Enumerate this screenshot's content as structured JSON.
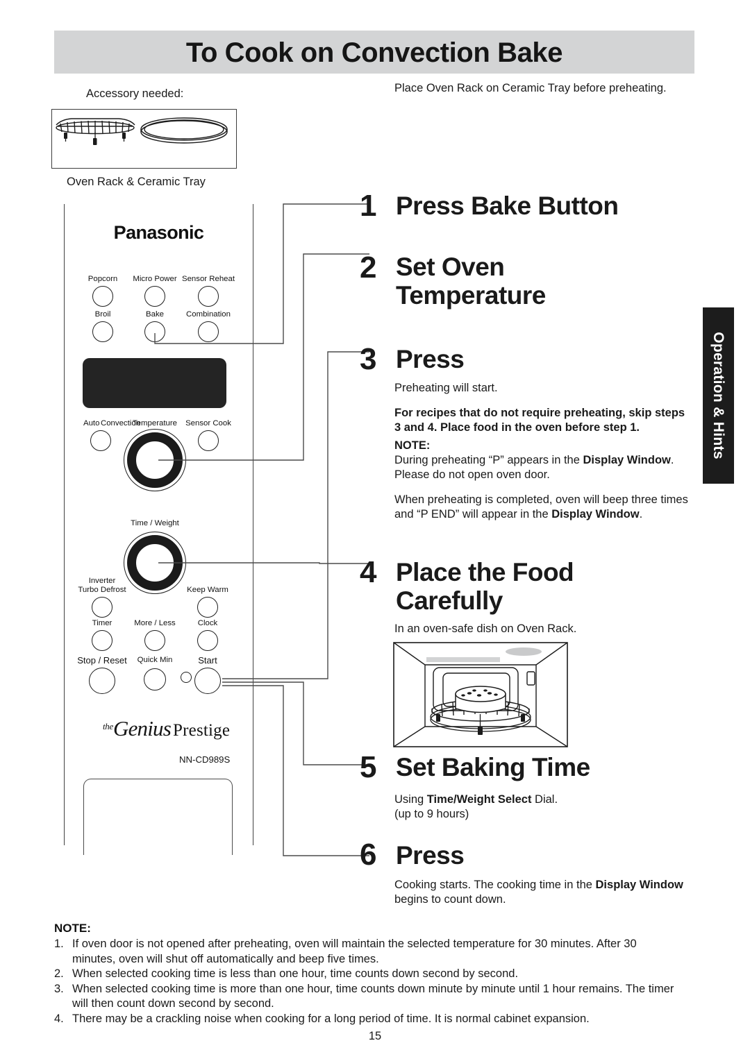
{
  "header": {
    "title": "To Cook on Convection Bake"
  },
  "side_tab": {
    "label": "Operation & Hints"
  },
  "accessory": {
    "label": "Accessory needed:",
    "caption": "Oven Rack & Ceramic Tray"
  },
  "intro": {
    "text": "Place Oven Rack on Ceramic Tray before preheating."
  },
  "panel": {
    "brand": "Panasonic",
    "model": "NN-CD989S",
    "logo_the": "the",
    "logo_script": "Genius",
    "logo_prestige": "Prestige",
    "buttons": [
      {
        "label": "Popcorn"
      },
      {
        "label": "Micro Power"
      },
      {
        "label": "Sensor Reheat"
      },
      {
        "label": "Broil"
      },
      {
        "label": "Bake"
      },
      {
        "label": "Combination"
      },
      {
        "label": "Auto Convection"
      },
      {
        "label": "Sensor Cook"
      },
      {
        "label": "Inverter\nTurbo Defrost"
      },
      {
        "label": "Keep Warm"
      },
      {
        "label": "Timer"
      },
      {
        "label": "More / Less"
      },
      {
        "label": "Clock"
      },
      {
        "label": "Stop / Reset"
      },
      {
        "label": "Quick Min"
      },
      {
        "label": "Start"
      }
    ],
    "button_labels": {
      "popcorn": "Popcorn",
      "micro_power": "Micro Power",
      "sensor_reheat": "Sensor Reheat",
      "broil": "Broil",
      "bake": "Bake",
      "combination": "Combination",
      "auto": "Auto",
      "convection": "Convection",
      "sensor_cook": "Sensor Cook",
      "inverter": "Inverter",
      "turbo_defrost": "Turbo Defrost",
      "keep_warm": "Keep Warm",
      "timer": "Timer",
      "more_less": "More / Less",
      "clock": "Clock",
      "stop_reset": "Stop / Reset",
      "quick_min": "Quick Min",
      "start": "Start"
    },
    "dials": {
      "temperature": "Temperature",
      "time_weight": "Time / Weight"
    }
  },
  "steps": [
    {
      "num": "1",
      "title": "Press Bake Button",
      "body": ""
    },
    {
      "num": "2",
      "title": "Set Oven Temperature",
      "body": ""
    },
    {
      "num": "3",
      "title": "Press",
      "body_line1": "Preheating will start.",
      "body_bold": "For recipes that do not require preheating, skip steps 3 and 4. Place food in the oven before step 1.",
      "note_head": "NOTE:",
      "note_p1_a": "During preheating “P” appears in the ",
      "note_p1_b": "Display Window",
      "note_p1_c": ". Please do not open oven door.",
      "note_p2_a": "When preheating is completed, oven will beep three times and “P END” will appear in the ",
      "note_p2_b": "Display Window",
      "note_p2_c": "."
    },
    {
      "num": "4",
      "title": "Place the Food Carefully",
      "body": "In an oven-safe dish on Oven Rack."
    },
    {
      "num": "5",
      "title": "Set Baking Time",
      "body_a": "Using ",
      "body_b": "Time/Weight Select",
      "body_c": " Dial.",
      "body_d": "(up to 9 hours)"
    },
    {
      "num": "6",
      "title": "Press",
      "body_a": "Cooking starts. The cooking time in the ",
      "body_b": "Display Window",
      "body_c": " begins to count down."
    }
  ],
  "bottom_note": {
    "head": "NOTE:",
    "items": [
      {
        "marker": "1.",
        "text": "If oven door is not opened after preheating, oven will maintain the selected temperature for 30 minutes. After 30 minutes, oven will shut off automatically and beep five times."
      },
      {
        "marker": "2.",
        "text": "When selected cooking time is less than one hour, time counts down second by second."
      },
      {
        "marker": "3.",
        "text": "When selected cooking time is more than one hour, time counts down minute by minute until 1 hour remains. The timer will then count down second by second."
      },
      {
        "marker": "4.",
        "text": "There may be a crackling noise when cooking for a long period of time. It is normal cabinet expansion."
      }
    ]
  },
  "page_number": "15",
  "colors": {
    "header_bg": "#d3d4d5",
    "tab_bg": "#1c1c1c",
    "display_bg": "#242424",
    "text": "#1a1a1a"
  }
}
